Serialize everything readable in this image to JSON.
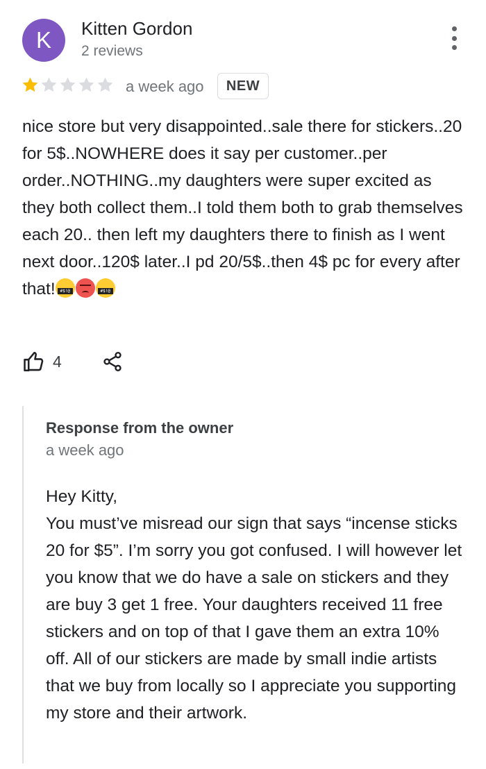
{
  "review": {
    "avatar_letter": "K",
    "avatar_color": "#7e57c2",
    "author": "Kitten Gordon",
    "author_meta": "2 reviews",
    "rating": 1,
    "max_rating": 5,
    "star_color_filled": "#fbbc04",
    "star_color_empty": "#dadce0",
    "date": "a week ago",
    "badge": "NEW",
    "text": "nice store but very disappointed..sale there for stickers..20 for 5$..NOWHERE does it say per customer..per order..NOTHING..my daughters were super excited as they both collect them..I told them both to grab themselves each 20.. then left my daughters there to finish as I went next door..120$ later..I pd 20/5$..then 4$ pc for every after that!",
    "emojis": [
      "face-with-symbols-on-mouth",
      "pouting-face",
      "face-with-symbols-on-mouth"
    ],
    "like_count": "4",
    "icons": {
      "menu": "more-vert-icon",
      "like": "thumbs-up-icon",
      "share": "share-icon"
    }
  },
  "owner_response": {
    "heading": "Response from the owner",
    "date": "a week ago",
    "text": "Hey Kitty,\nYou must’ve misread our sign that says “incense sticks 20 for $5”. I’m sorry you got confused. I will however let you know that we do have a sale on stickers and they are buy 3 get 1 free. Your daughters received 11 free stickers and on top of that I gave them an extra 10% off. All of our stickers are made by small indie artists that we buy from locally so I appreciate you supporting my store and their artwork."
  }
}
